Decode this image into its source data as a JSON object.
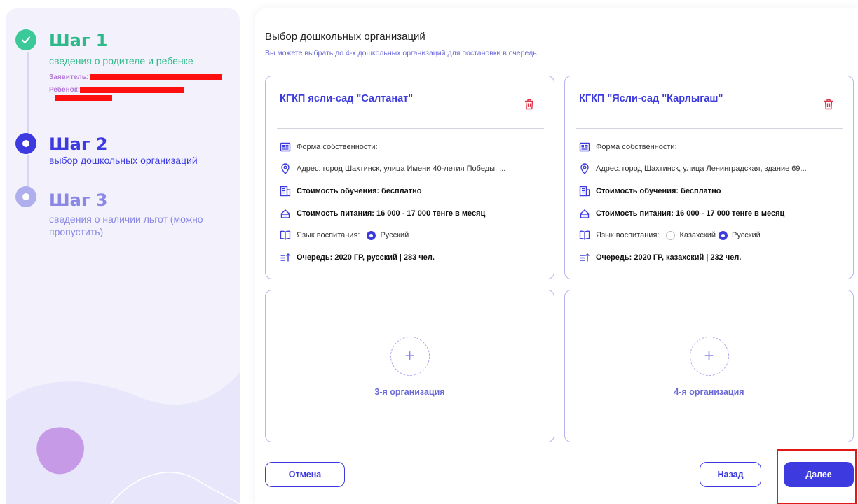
{
  "sidebar": {
    "steps": [
      {
        "title": "Шаг 1",
        "subtitle": "сведения о родителе и ребенке",
        "applicant_label": "Заявитель:",
        "child_label": "Ребенок:"
      },
      {
        "title": "Шаг 2",
        "subtitle": "выбор дошкольных организаций"
      },
      {
        "title": "Шаг 3",
        "subtitle": "сведения о наличии льгот (можно пропустить)"
      }
    ]
  },
  "main": {
    "title": "Выбор дошкольных организаций",
    "subtitle": "Вы можете выбрать до 4-х дошкольных организаций для постановки в очередь",
    "cards": [
      {
        "name": "КГКП ясли-сад \"Салтанат\"",
        "ownership": "Форма собственности:",
        "address": "Адрес: город Шахтинск, улица Имени 40-летия Победы, ...",
        "tuition": "Стоимость обучения: бесплатно",
        "meals": "Стоимость питания: 16 000 - 17 000 тенге в месяц",
        "language_label": "Язык воспитания:",
        "languages": [
          "Русский"
        ],
        "queue": "Очередь: 2020 ГР, русский | 283 чел."
      },
      {
        "name": "КГКП \"Ясли-сад \"Карлыгаш\"",
        "ownership": "Форма собственности:",
        "address": "Адрес: город Шахтинск, улица Ленинградская, здание 69...",
        "tuition": "Стоимость обучения: бесплатно",
        "meals": "Стоимость питания: 16 000 - 17 000 тенге в месяц",
        "language_label": "Язык воспитания:",
        "languages": [
          "Казахский",
          "Русский"
        ],
        "queue": "Очередь: 2020 ГР, казахский | 232 чел."
      }
    ],
    "empty_slots": [
      {
        "label": "3-я организация"
      },
      {
        "label": "4-я организация"
      }
    ]
  },
  "buttons": {
    "cancel": "Отмена",
    "back": "Назад",
    "next": "Далее"
  },
  "colors": {
    "accent": "#3d3be0",
    "success": "#2fb98a",
    "danger": "#e0334a",
    "highlight_box": "#e01818"
  }
}
